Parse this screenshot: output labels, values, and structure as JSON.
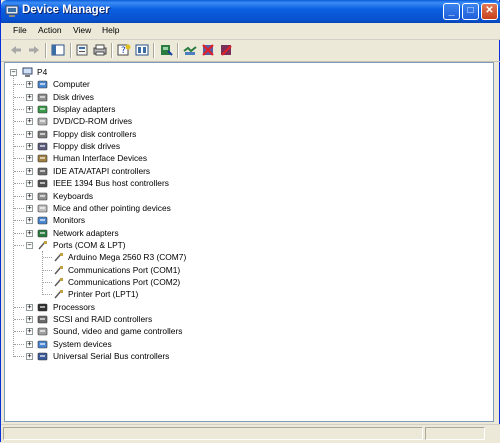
{
  "window": {
    "title": "Device Manager"
  },
  "title_buttons": {
    "minimize": "_",
    "maximize": "□",
    "close": "✕"
  },
  "menu": [
    "File",
    "Action",
    "View",
    "Help"
  ],
  "toolbar": [
    "back-icon",
    "forward-icon",
    "console-tree-icon",
    "properties-icon",
    "print-icon",
    "help-icon",
    "view-icon",
    "update-driver-icon",
    "scan-hardware-icon",
    "uninstall-icon",
    "disable-icon"
  ],
  "tree": {
    "root": "P4",
    "categories": [
      {
        "label": "Computer",
        "icon": "computer-icon",
        "expanded": false
      },
      {
        "label": "Disk drives",
        "icon": "disk-drive-icon",
        "expanded": false
      },
      {
        "label": "Display adapters",
        "icon": "display-adapter-icon",
        "expanded": false
      },
      {
        "label": "DVD/CD-ROM drives",
        "icon": "dvd-drive-icon",
        "expanded": false
      },
      {
        "label": "Floppy disk controllers",
        "icon": "floppy-controller-icon",
        "expanded": false
      },
      {
        "label": "Floppy disk drives",
        "icon": "floppy-drive-icon",
        "expanded": false
      },
      {
        "label": "Human Interface Devices",
        "icon": "hid-icon",
        "expanded": false
      },
      {
        "label": "IDE ATA/ATAPI controllers",
        "icon": "ide-controller-icon",
        "expanded": false
      },
      {
        "label": "IEEE 1394 Bus host controllers",
        "icon": "ieee1394-icon",
        "expanded": false
      },
      {
        "label": "Keyboards",
        "icon": "keyboard-icon",
        "expanded": false
      },
      {
        "label": "Mice and other pointing devices",
        "icon": "mouse-icon",
        "expanded": false
      },
      {
        "label": "Monitors",
        "icon": "monitor-icon",
        "expanded": false
      },
      {
        "label": "Network adapters",
        "icon": "network-adapter-icon",
        "expanded": false
      },
      {
        "label": "Ports (COM & LPT)",
        "icon": "port-icon",
        "expanded": true,
        "children": [
          {
            "label": "Arduino Mega 2560 R3 (COM7)",
            "icon": "port-icon"
          },
          {
            "label": "Communications Port (COM1)",
            "icon": "port-icon"
          },
          {
            "label": "Communications Port (COM2)",
            "icon": "port-icon"
          },
          {
            "label": "Printer Port (LPT1)",
            "icon": "port-icon"
          }
        ]
      },
      {
        "label": "Processors",
        "icon": "processor-icon",
        "expanded": false
      },
      {
        "label": "SCSI and RAID controllers",
        "icon": "scsi-icon",
        "expanded": false
      },
      {
        "label": "Sound, video and game controllers",
        "icon": "sound-icon",
        "expanded": false
      },
      {
        "label": "System devices",
        "icon": "system-device-icon",
        "expanded": false
      },
      {
        "label": "Universal Serial Bus controllers",
        "icon": "usb-icon",
        "expanded": false
      }
    ]
  },
  "colors": {
    "titlebar": "#0a5fe0",
    "chrome": "#ece9d8",
    "content": "#ffffff"
  }
}
